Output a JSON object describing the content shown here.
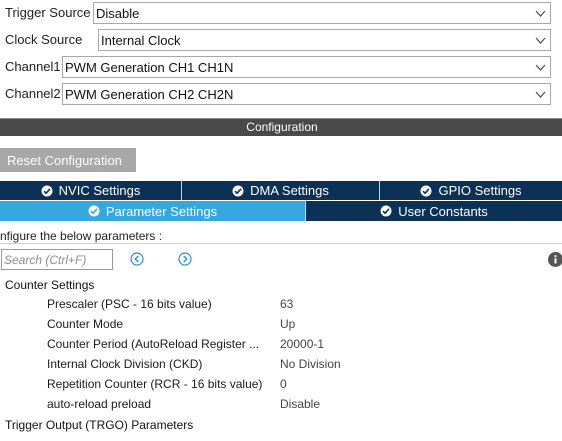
{
  "mode": {
    "trigger_source": {
      "label": "Trigger Source",
      "value": "Disable"
    },
    "clock_source": {
      "label": "Clock Source",
      "value": "Internal Clock"
    },
    "channel1": {
      "label": "Channel1",
      "value": "PWM Generation CH1 CH1N"
    },
    "channel2": {
      "label": "Channel2",
      "value": "PWM Generation CH2 CH2N"
    }
  },
  "configuration": {
    "title": "Configuration",
    "reset_label": "Reset Configuration"
  },
  "tabs": {
    "row1": [
      {
        "label": "NVIC Settings",
        "active": false
      },
      {
        "label": "DMA Settings",
        "active": false
      },
      {
        "label": "GPIO Settings",
        "active": false
      }
    ],
    "row2": [
      {
        "label": "Parameter Settings",
        "active": true
      },
      {
        "label": "User Constants",
        "active": false
      }
    ]
  },
  "params": {
    "hint": "nfigure the below parameters :",
    "search_placeholder": "Search (Ctrl+F)",
    "sections": [
      {
        "title": "Counter Settings",
        "rows": [
          {
            "name": "Prescaler (PSC - 16 bits value)",
            "value": "63"
          },
          {
            "name": "Counter Mode",
            "value": "Up"
          },
          {
            "name": "Counter Period (AutoReload Register ...",
            "value": "20000-1"
          },
          {
            "name": "Internal Clock Division (CKD)",
            "value": "No Division"
          },
          {
            "name": "Repetition Counter (RCR - 16 bits value)",
            "value": "0"
          },
          {
            "name": "auto-reload preload",
            "value": "Disable"
          }
        ]
      },
      {
        "title": "Trigger Output (TRGO) Parameters",
        "rows": []
      }
    ]
  },
  "colors": {
    "tab_dark": "#0b3157",
    "tab_active": "#35a8e0",
    "config_bar": "#4a4a4a",
    "reset_button": "#a8a8a8",
    "nav_icon": "#2a8fd6"
  },
  "icons": {
    "tab_status": "check-circle-icon",
    "search_prev": "chevron-left-circle-icon",
    "search_next": "chevron-right-circle-icon",
    "info": "info-icon",
    "dropdown": "chevron-down-icon"
  }
}
